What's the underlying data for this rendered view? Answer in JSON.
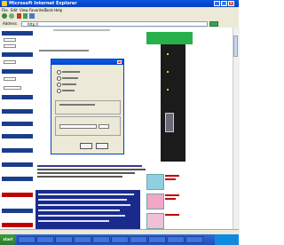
{
  "window": {
    "title": "Microsoft Internet Explorer"
  },
  "menu": [
    "File",
    "Edit",
    "View",
    "Favorites",
    "Tools",
    "Help"
  ],
  "address": {
    "label": "Address",
    "value": "http://"
  },
  "page_heading": "",
  "dialog": {
    "title": "",
    "options": [
      "",
      "",
      "",
      ""
    ],
    "ok_label": "",
    "cancel_label": ""
  },
  "taskbar": {
    "start_label": "start",
    "clock": ""
  },
  "colors": {
    "title_blue": "#0a55e0",
    "nav_blue": "#1a3d8c",
    "green_banner": "#28b04a",
    "panel_blue": "#1a2a8c",
    "link_red": "#c00000"
  }
}
